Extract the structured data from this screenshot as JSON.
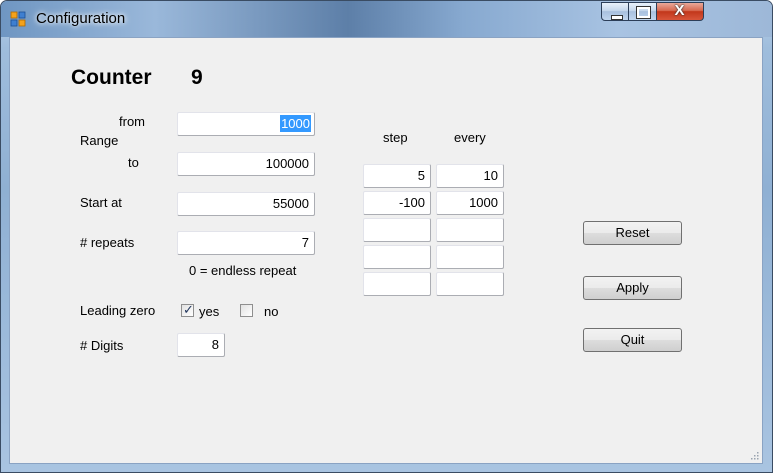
{
  "window": {
    "title": "Configuration",
    "icon": "form-app-icon"
  },
  "controls": {
    "minimize": "minimize-icon",
    "maximize": "maximize-icon",
    "close": "close-icon",
    "close_glyph": "X"
  },
  "counter": {
    "label": "Counter",
    "value": "9"
  },
  "range": {
    "label": "Range",
    "from_label": "from",
    "from_value": "1000",
    "to_label": "to",
    "to_value": "100000"
  },
  "start": {
    "label": "Start at",
    "value": "55000"
  },
  "repeats": {
    "label": "# repeats",
    "value": "7",
    "hint": "0 = endless repeat"
  },
  "leading_zero": {
    "label": "Leading zero",
    "yes_label": "yes",
    "yes_checked": true,
    "no_label": "no",
    "no_checked": false
  },
  "digits": {
    "label": "# Digits",
    "value": "8"
  },
  "steps": {
    "step_header": "step",
    "every_header": "every",
    "rows": [
      {
        "step": "5",
        "every": "10"
      },
      {
        "step": "-100",
        "every": "1000"
      },
      {
        "step": "",
        "every": ""
      },
      {
        "step": "",
        "every": ""
      },
      {
        "step": "",
        "every": ""
      }
    ]
  },
  "buttons": {
    "reset": "Reset",
    "apply": "Apply",
    "quit": "Quit"
  }
}
